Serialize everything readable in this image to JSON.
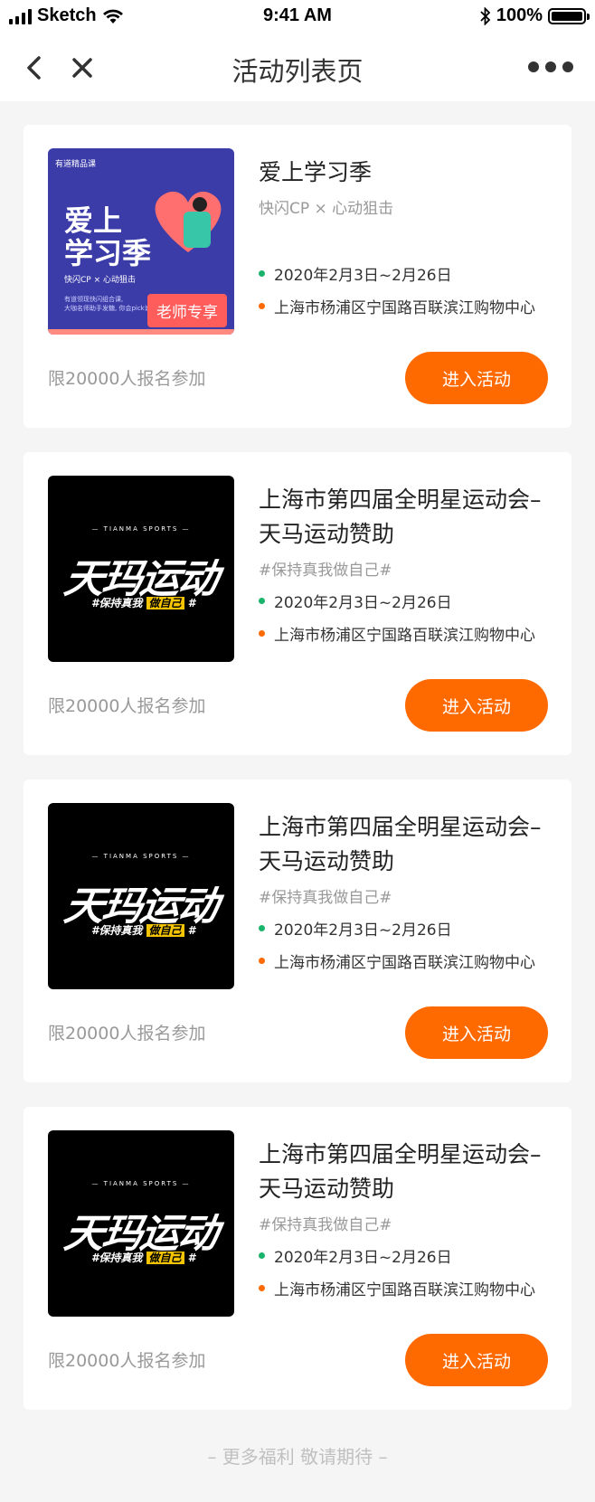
{
  "status_bar": {
    "carrier": "Sketch",
    "time": "9:41 AM",
    "battery": "100%",
    "battery_level": 1.0
  },
  "nav": {
    "title": "活动列表页"
  },
  "cards": [
    {
      "title": "爱上学习季",
      "subtitle": "快闪CP × 心动狙击",
      "date": "2020年2月3日~2月26日",
      "location": "上海市杨浦区宁国路百联滨江购物中心",
      "limit": "限20000人报名参加",
      "button": "进入活动",
      "thumb": {
        "brand": "有道精品课",
        "title_line1": "爱上",
        "title_line2": "学习季",
        "cp": "快闪CP × 心动狙击",
        "desc1": "有道领现快闪组合课,",
        "desc2": "大咖名师助手发糖, 你会pick谁?",
        "badge": "老师专享"
      }
    },
    {
      "title": "上海市第四届全明星运动会–天马运动赞助",
      "subtitle": "#保持真我做自己#",
      "date": "2020年2月3日~2月26日",
      "location": "上海市杨浦区宁国路百联滨江购物中心",
      "limit": "限20000人报名参加",
      "button": "进入活动",
      "thumb": {
        "sub": "— TIANMA SPORTS —",
        "logo": "天玛运动",
        "tag_a": "#保持真我",
        "tag_b": "做自己",
        "tag_c": "#"
      }
    },
    {
      "title": "上海市第四届全明星运动会–天马运动赞助",
      "subtitle": "#保持真我做自己#",
      "date": "2020年2月3日~2月26日",
      "location": "上海市杨浦区宁国路百联滨江购物中心",
      "limit": "限20000人报名参加",
      "button": "进入活动",
      "thumb": {
        "sub": "— TIANMA SPORTS —",
        "logo": "天玛运动",
        "tag_a": "#保持真我",
        "tag_b": "做自己",
        "tag_c": "#"
      }
    },
    {
      "title": "上海市第四届全明星运动会–天马运动赞助",
      "subtitle": "#保持真我做自己#",
      "date": "2020年2月3日~2月26日",
      "location": "上海市杨浦区宁国路百联滨江购物中心",
      "limit": "限20000人报名参加",
      "button": "进入活动",
      "thumb": {
        "sub": "— TIANMA SPORTS —",
        "logo": "天玛运动",
        "tag_a": "#保持真我",
        "tag_b": "做自己",
        "tag_c": "#"
      }
    }
  ],
  "footer": "– 更多福利 敬请期待 –",
  "colors": {
    "accent": "#ff6a00",
    "date_dot": "#1ab36b",
    "location_dot": "#ff6a00"
  },
  "icons": {
    "back": "chevron-left-icon",
    "close": "close-icon",
    "more": "more-dots-icon"
  }
}
